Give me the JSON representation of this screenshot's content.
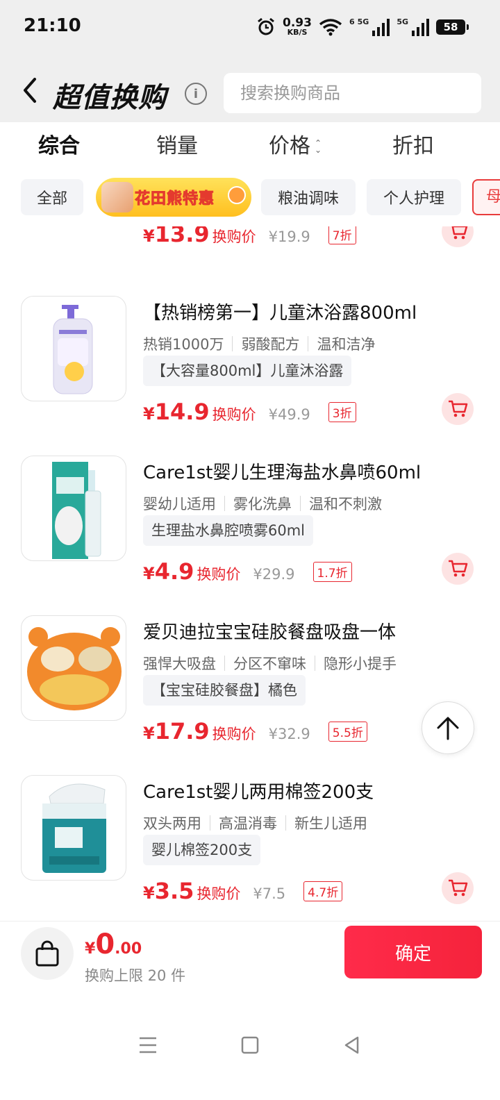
{
  "status_bar": {
    "time": "21:10",
    "net_speed_value": "0.93",
    "net_speed_unit": "KB/S",
    "wifi_label": "6",
    "signal1_label": "5G",
    "signal2_label": "5G",
    "battery": "58"
  },
  "header": {
    "title": "超值换购",
    "info_icon": "i",
    "search_placeholder": "搜索换购商品"
  },
  "sort_tabs": [
    {
      "label": "综合",
      "active": true
    },
    {
      "label": "销量"
    },
    {
      "label": "价格"
    },
    {
      "label": "折扣"
    }
  ],
  "categories": {
    "all": "全部",
    "promo": "花田熊特惠",
    "grain_oil": "粮油调味",
    "personal_care": "个人护理",
    "partial": "母"
  },
  "items": [
    {
      "price": "13.9",
      "price_label": "换购价",
      "original": "¥19.9",
      "discount": "7折"
    },
    {
      "name": "【热销榜第一】儿童沐浴露800ml",
      "tags": [
        "热销1000万",
        "弱酸配方",
        "温和洁净"
      ],
      "spec": "【大容量800ml】儿童沐浴露",
      "price": "14.9",
      "price_label": "换购价",
      "original": "¥49.9",
      "discount": "3折"
    },
    {
      "name": "Care1st婴儿生理海盐水鼻喷60ml",
      "tags": [
        "婴幼儿适用",
        "雾化洗鼻",
        "温和不刺激"
      ],
      "spec": "生理盐水鼻腔喷雾60ml",
      "price": "4.9",
      "price_label": "换购价",
      "original": "¥29.9",
      "discount": "1.7折"
    },
    {
      "name": "爱贝迪拉宝宝硅胶餐盘吸盘一体",
      "tags": [
        "强悍大吸盘",
        "分区不窜味",
        "隐形小提手"
      ],
      "spec": "【宝宝硅胶餐盘】橘色",
      "price": "17.9",
      "price_label": "换购价",
      "original": "¥32.9",
      "discount": "5.5折"
    },
    {
      "name": "Care1st婴儿两用棉签200支",
      "tags": [
        "双头两用",
        "高温消毒",
        "新生儿适用"
      ],
      "spec": "婴儿棉签200支",
      "price": "3.5",
      "price_label": "换购价",
      "original": "¥7.5",
      "discount": "4.7折"
    }
  ],
  "currency": "¥",
  "footer": {
    "currency": "¥",
    "total_int": "0",
    "total_dec": ".00",
    "limit_text": "换购上限 20 件",
    "confirm_label": "确定"
  },
  "colors": {
    "accent": "#e8262f",
    "confirm_button": "#ff2b4a"
  }
}
